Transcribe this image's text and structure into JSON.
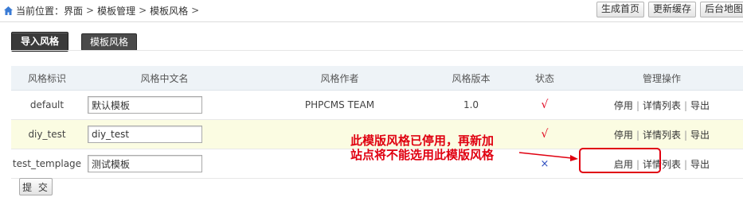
{
  "breadcrumb": {
    "prefix": "当前位置：界面",
    "items": [
      "模板管理",
      "模板风格"
    ],
    "sep": ">"
  },
  "top_buttons": [
    "生成首页",
    "更新缓存",
    "后台地图"
  ],
  "tabs": {
    "import": "导入风格",
    "style": "模板风格"
  },
  "table": {
    "headers": [
      "风格标识",
      "风格中文名",
      "风格作者",
      "风格版本",
      "状态",
      "管理操作"
    ],
    "rows": [
      {
        "id": "default",
        "name": "默认模板",
        "author": "PHPCMS TEAM",
        "version": "1.0",
        "status": "√",
        "ops": [
          "停用",
          "详情列表",
          "导出"
        ]
      },
      {
        "id": "diy_test",
        "name": "diy_test",
        "author": "",
        "version": "",
        "status": "√",
        "ops": [
          "停用",
          "详情列表",
          "导出"
        ]
      },
      {
        "id": "test_templage",
        "name": "测试模板",
        "author": "",
        "version": "",
        "status": "×",
        "ops": [
          "启用",
          "详情列表",
          "导出"
        ]
      }
    ]
  },
  "submit_label": "提 交",
  "annotation": {
    "line1": "此模版风格已停用，再新加",
    "line2": "站点将不能选用此模版风格",
    "color": "#e00010"
  }
}
